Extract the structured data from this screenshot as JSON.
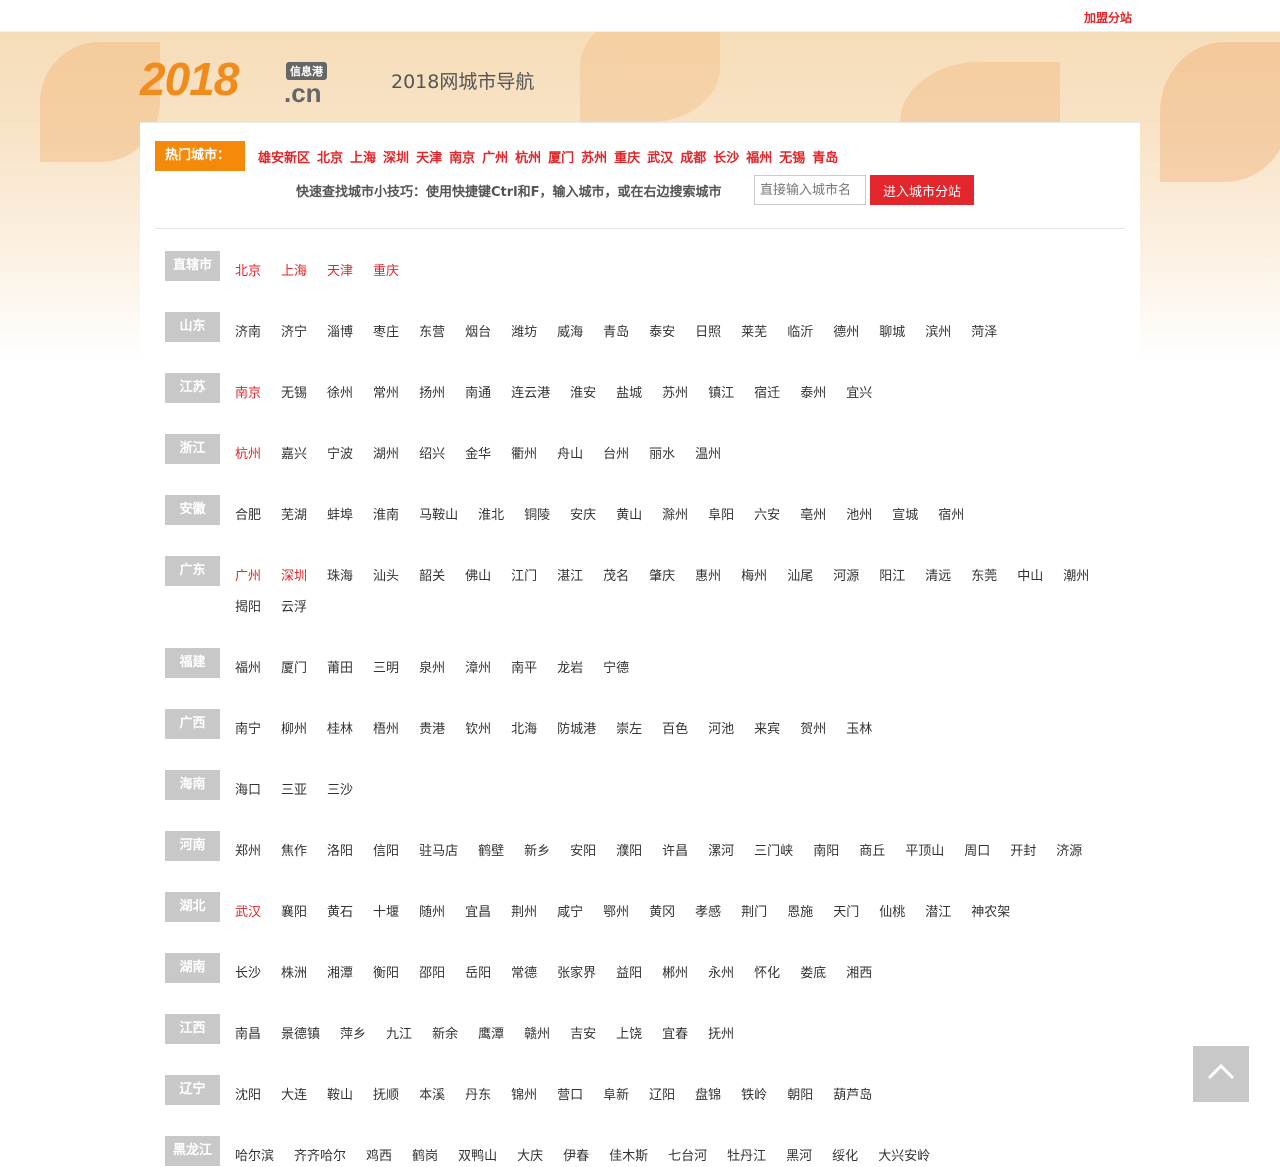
{
  "topbar": {
    "join_link": "加盟分站"
  },
  "header": {
    "logo_number": "2018",
    "logo_tag": "信息港",
    "logo_domain": ".cn",
    "site_title": "2018网城市导航"
  },
  "hot": {
    "label": "热门城市：",
    "cities": [
      "雄安新区",
      "北京",
      "上海",
      "深圳",
      "天津",
      "南京",
      "广州",
      "杭州",
      "厦门",
      "苏州",
      "重庆",
      "武汉",
      "成都",
      "长沙",
      "福州",
      "无锡",
      "青岛"
    ]
  },
  "search": {
    "tip": "快速查找城市小技巧：使用快捷键Ctrl和F，输入城市，或在右边搜索城市",
    "placeholder": "直接输入城市名",
    "button": "进入城市分站"
  },
  "provinces": [
    {
      "name": "直辖市",
      "cities": [
        {
          "n": "北京",
          "hot": true
        },
        {
          "n": "上海",
          "hot": true
        },
        {
          "n": "天津",
          "hot": true
        },
        {
          "n": "重庆",
          "hot": true
        }
      ]
    },
    {
      "name": "山东",
      "cities": [
        {
          "n": "济南"
        },
        {
          "n": "济宁"
        },
        {
          "n": "淄博"
        },
        {
          "n": "枣庄"
        },
        {
          "n": "东营"
        },
        {
          "n": "烟台"
        },
        {
          "n": "潍坊"
        },
        {
          "n": "威海"
        },
        {
          "n": "青岛"
        },
        {
          "n": "泰安"
        },
        {
          "n": "日照"
        },
        {
          "n": "莱芜"
        },
        {
          "n": "临沂"
        },
        {
          "n": "德州"
        },
        {
          "n": "聊城"
        },
        {
          "n": "滨州"
        },
        {
          "n": "菏泽"
        }
      ]
    },
    {
      "name": "江苏",
      "cities": [
        {
          "n": "南京",
          "hot": true
        },
        {
          "n": "无锡"
        },
        {
          "n": "徐州"
        },
        {
          "n": "常州"
        },
        {
          "n": "扬州"
        },
        {
          "n": "南通"
        },
        {
          "n": "连云港"
        },
        {
          "n": "淮安"
        },
        {
          "n": "盐城"
        },
        {
          "n": "苏州"
        },
        {
          "n": "镇江"
        },
        {
          "n": "宿迁"
        },
        {
          "n": "泰州"
        },
        {
          "n": "宜兴"
        }
      ]
    },
    {
      "name": "浙江",
      "cities": [
        {
          "n": "杭州",
          "hot": true
        },
        {
          "n": "嘉兴"
        },
        {
          "n": "宁波"
        },
        {
          "n": "湖州"
        },
        {
          "n": "绍兴"
        },
        {
          "n": "金华"
        },
        {
          "n": "衢州"
        },
        {
          "n": "舟山"
        },
        {
          "n": "台州"
        },
        {
          "n": "丽水"
        },
        {
          "n": "温州"
        }
      ]
    },
    {
      "name": "安徽",
      "cities": [
        {
          "n": "合肥"
        },
        {
          "n": "芜湖"
        },
        {
          "n": "蚌埠"
        },
        {
          "n": "淮南"
        },
        {
          "n": "马鞍山"
        },
        {
          "n": "淮北"
        },
        {
          "n": "铜陵"
        },
        {
          "n": "安庆"
        },
        {
          "n": "黄山"
        },
        {
          "n": "滁州"
        },
        {
          "n": "阜阳"
        },
        {
          "n": "六安"
        },
        {
          "n": "亳州"
        },
        {
          "n": "池州"
        },
        {
          "n": "宣城"
        },
        {
          "n": "宿州"
        }
      ]
    },
    {
      "name": "广东",
      "cities": [
        {
          "n": "广州",
          "hot": true
        },
        {
          "n": "深圳",
          "hot": true
        },
        {
          "n": "珠海"
        },
        {
          "n": "汕头"
        },
        {
          "n": "韶关"
        },
        {
          "n": "佛山"
        },
        {
          "n": "江门"
        },
        {
          "n": "湛江"
        },
        {
          "n": "茂名"
        },
        {
          "n": "肇庆"
        },
        {
          "n": "惠州"
        },
        {
          "n": "梅州"
        },
        {
          "n": "汕尾"
        },
        {
          "n": "河源"
        },
        {
          "n": "阳江"
        },
        {
          "n": "清远"
        },
        {
          "n": "东莞"
        },
        {
          "n": "中山"
        },
        {
          "n": "潮州"
        },
        {
          "n": "揭阳"
        },
        {
          "n": "云浮"
        }
      ]
    },
    {
      "name": "福建",
      "cities": [
        {
          "n": "福州"
        },
        {
          "n": "厦门"
        },
        {
          "n": "莆田"
        },
        {
          "n": "三明"
        },
        {
          "n": "泉州"
        },
        {
          "n": "漳州"
        },
        {
          "n": "南平"
        },
        {
          "n": "龙岩"
        },
        {
          "n": "宁德"
        }
      ]
    },
    {
      "name": "广西",
      "cities": [
        {
          "n": "南宁"
        },
        {
          "n": "柳州"
        },
        {
          "n": "桂林"
        },
        {
          "n": "梧州"
        },
        {
          "n": "贵港"
        },
        {
          "n": "钦州"
        },
        {
          "n": "北海"
        },
        {
          "n": "防城港"
        },
        {
          "n": "崇左"
        },
        {
          "n": "百色"
        },
        {
          "n": "河池"
        },
        {
          "n": "来宾"
        },
        {
          "n": "贺州"
        },
        {
          "n": "玉林"
        }
      ]
    },
    {
      "name": "海南",
      "cities": [
        {
          "n": "海口"
        },
        {
          "n": "三亚"
        },
        {
          "n": "三沙"
        }
      ]
    },
    {
      "name": "河南",
      "cities": [
        {
          "n": "郑州"
        },
        {
          "n": "焦作"
        },
        {
          "n": "洛阳"
        },
        {
          "n": "信阳"
        },
        {
          "n": "驻马店"
        },
        {
          "n": "鹤壁"
        },
        {
          "n": "新乡"
        },
        {
          "n": "安阳"
        },
        {
          "n": "濮阳"
        },
        {
          "n": "许昌"
        },
        {
          "n": "漯河"
        },
        {
          "n": "三门峡"
        },
        {
          "n": "南阳"
        },
        {
          "n": "商丘"
        },
        {
          "n": "平顶山"
        },
        {
          "n": "周口"
        },
        {
          "n": "开封"
        },
        {
          "n": "济源"
        }
      ]
    },
    {
      "name": "湖北",
      "cities": [
        {
          "n": "武汉",
          "hot": true
        },
        {
          "n": "襄阳"
        },
        {
          "n": "黄石"
        },
        {
          "n": "十堰"
        },
        {
          "n": "随州"
        },
        {
          "n": "宜昌"
        },
        {
          "n": "荆州"
        },
        {
          "n": "咸宁"
        },
        {
          "n": "鄂州"
        },
        {
          "n": "黄冈"
        },
        {
          "n": "孝感"
        },
        {
          "n": "荆门"
        },
        {
          "n": "恩施"
        },
        {
          "n": "天门"
        },
        {
          "n": "仙桃"
        },
        {
          "n": "潜江"
        },
        {
          "n": "神农架"
        }
      ]
    },
    {
      "name": "湖南",
      "cities": [
        {
          "n": "长沙"
        },
        {
          "n": "株洲"
        },
        {
          "n": "湘潭"
        },
        {
          "n": "衡阳"
        },
        {
          "n": "邵阳"
        },
        {
          "n": "岳阳"
        },
        {
          "n": "常德"
        },
        {
          "n": "张家界"
        },
        {
          "n": "益阳"
        },
        {
          "n": "郴州"
        },
        {
          "n": "永州"
        },
        {
          "n": "怀化"
        },
        {
          "n": "娄底"
        },
        {
          "n": "湘西"
        }
      ]
    },
    {
      "name": "江西",
      "cities": [
        {
          "n": "南昌"
        },
        {
          "n": "景德镇"
        },
        {
          "n": "萍乡"
        },
        {
          "n": "九江"
        },
        {
          "n": "新余"
        },
        {
          "n": "鹰潭"
        },
        {
          "n": "赣州"
        },
        {
          "n": "吉安"
        },
        {
          "n": "上饶"
        },
        {
          "n": "宜春"
        },
        {
          "n": "抚州"
        }
      ]
    },
    {
      "name": "辽宁",
      "cities": [
        {
          "n": "沈阳"
        },
        {
          "n": "大连"
        },
        {
          "n": "鞍山"
        },
        {
          "n": "抚顺"
        },
        {
          "n": "本溪"
        },
        {
          "n": "丹东"
        },
        {
          "n": "锦州"
        },
        {
          "n": "营口"
        },
        {
          "n": "阜新"
        },
        {
          "n": "辽阳"
        },
        {
          "n": "盘锦"
        },
        {
          "n": "铁岭"
        },
        {
          "n": "朝阳"
        },
        {
          "n": "葫芦岛"
        }
      ]
    },
    {
      "name": "黑龙江",
      "cities": [
        {
          "n": "哈尔滨"
        },
        {
          "n": "齐齐哈尔"
        },
        {
          "n": "鸡西"
        },
        {
          "n": "鹤岗"
        },
        {
          "n": "双鸭山"
        },
        {
          "n": "大庆"
        },
        {
          "n": "伊春"
        },
        {
          "n": "佳木斯"
        },
        {
          "n": "七台河"
        },
        {
          "n": "牡丹江"
        },
        {
          "n": "黑河"
        },
        {
          "n": "绥化"
        },
        {
          "n": "大兴安岭"
        }
      ]
    }
  ],
  "colors": {
    "accent_red": "#e2262b",
    "hot_orange": "#f58a0a",
    "label_gray": "#c8c8c8"
  },
  "icons": {
    "back_to_top": "chevron-up-icon"
  }
}
